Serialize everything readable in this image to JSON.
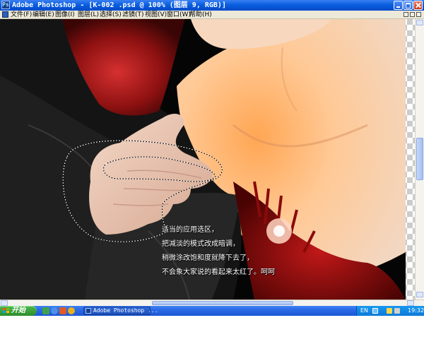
{
  "window": {
    "title": "Adobe Photoshop - [K-002 .psd @ 100% (图层 9, RGB)]"
  },
  "menu": {
    "items": [
      "文件(F)",
      "编辑(E)",
      "图像(I)",
      "图层(L)",
      "选择(S)",
      "滤镜(T)",
      "视图(V)",
      "窗口(W)",
      "帮助(H)"
    ]
  },
  "annotation": {
    "lines": [
      "适当的应用选区，",
      "把减淡的模式改成暗调，",
      "稍微涂改饱和度就降下去了，",
      "不会象大家说的看起来太红了。呵呵"
    ]
  },
  "taskbar": {
    "start_label": "开始",
    "task_item_label": "Adobe Photoshop ...",
    "tray_language": "EN",
    "tray_time": "19:32"
  },
  "colors": {
    "titlebar": "#0a5fe0",
    "menubar": "#ece9d8",
    "taskbar": "#2b6ae6",
    "tray": "#1899f0",
    "start_button": "#2a8d2a"
  }
}
